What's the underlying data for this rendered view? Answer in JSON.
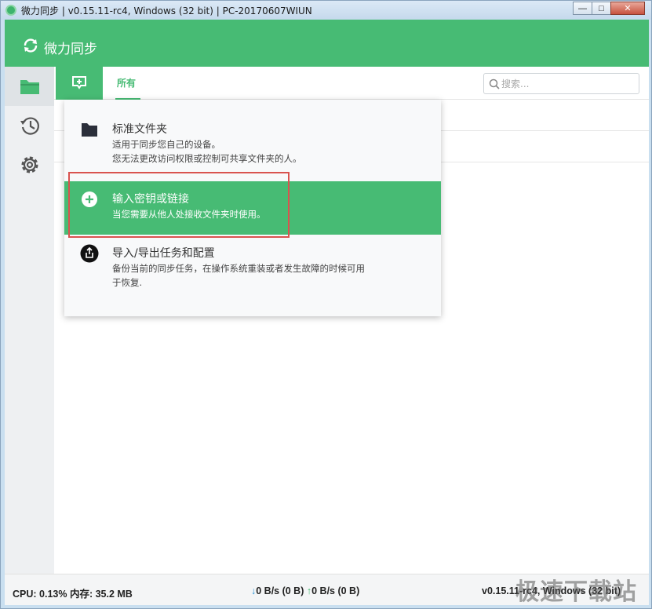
{
  "window": {
    "title": "微力同步 | v0.15.11-rc4, Windows (32 bit) | PC-20170607WIUN",
    "minimize_label": "—",
    "maximize_label": "□",
    "close_label": "✕"
  },
  "header": {
    "app_name": "微力同步"
  },
  "toolbar": {
    "tab_all": "所有",
    "search_placeholder": "搜索..."
  },
  "sidebar": {
    "items": [
      {
        "icon": "folder-icon",
        "active": true
      },
      {
        "icon": "history-icon",
        "active": false
      },
      {
        "icon": "gear-icon",
        "active": false
      }
    ]
  },
  "dropdown": {
    "items": [
      {
        "icon": "folder-icon",
        "title": "标准文件夹",
        "desc_line1": "适用于同步您自己的设备。",
        "desc_line2": "您无法更改访问权限或控制可共享文件夹的人。"
      },
      {
        "icon": "plus-circle-icon",
        "title": "输入密钥或链接",
        "desc_line1": "当您需要从他人处接收文件夹时使用。",
        "highlighted": true
      },
      {
        "icon": "export-icon",
        "title": "导入/导出任务和配置",
        "desc_line1": "备份当前的同步任务，在操作系统重装或者发生故障的时候可用",
        "desc_line2": "于恢复."
      }
    ]
  },
  "statusbar": {
    "cpu_mem": "CPU: 0.13% 内存: 35.2 MB",
    "down_arrow": "↓",
    "down_text": "0 B/s (0 B)",
    "up_arrow": "↑",
    "up_text": "0 B/s (0 B)",
    "version": "v0.15.11-rc4, Windows (32 bit)"
  },
  "watermark": "极速下载站",
  "colors": {
    "accent": "#47bb74",
    "highlight_border": "#d9534f",
    "download_arrow": "#2b93d6"
  }
}
